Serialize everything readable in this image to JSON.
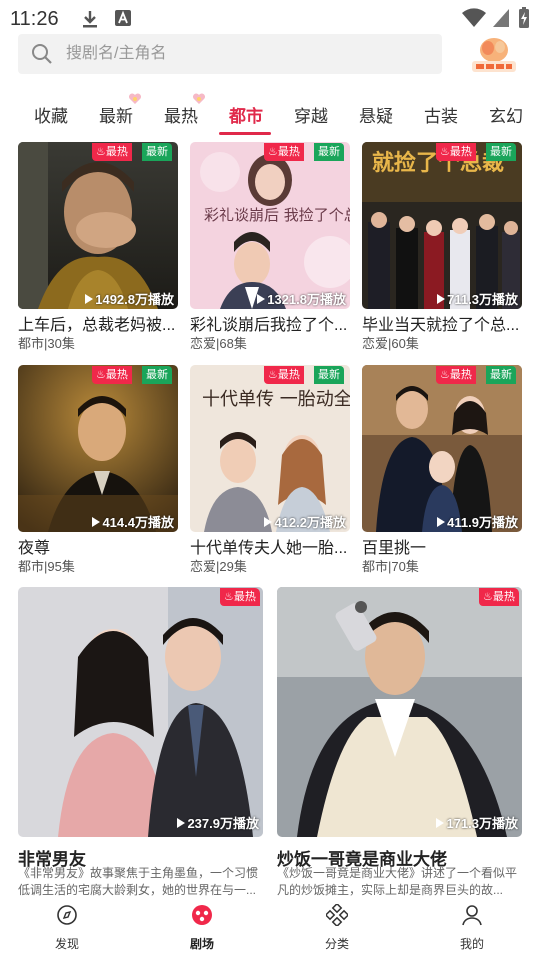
{
  "status_bar": {
    "time": "11:26"
  },
  "search": {
    "placeholder": "搜剧名/主角名",
    "value": ""
  },
  "welfare_logo_text": "领取福利",
  "tabs": [
    {
      "label": "收藏",
      "active": false,
      "badge": false
    },
    {
      "label": "最新",
      "active": false,
      "badge": true
    },
    {
      "label": "最热",
      "active": false,
      "badge": true
    },
    {
      "label": "都市",
      "active": true,
      "badge": false
    },
    {
      "label": "穿越",
      "active": false,
      "badge": false
    },
    {
      "label": "悬疑",
      "active": false,
      "badge": false
    },
    {
      "label": "古装",
      "active": false,
      "badge": false
    },
    {
      "label": "玄幻",
      "active": false,
      "badge": false
    }
  ],
  "badges": {
    "hot": "最热",
    "new": "最新"
  },
  "cards": [
    {
      "title": "上车后，总裁老妈被...",
      "meta": "都市|30集",
      "plays": "1492.8万播放",
      "hot": true,
      "new": true
    },
    {
      "title": "彩礼谈崩后我捡了个...",
      "meta": "恋爱|68集",
      "plays": "1321.8万播放",
      "hot": true,
      "new": true
    },
    {
      "title": "毕业当天就捡了个总...",
      "meta": "恋爱|60集",
      "plays": "711.3万播放",
      "hot": true,
      "new": true
    },
    {
      "title": "夜尊",
      "meta": "都市|95集",
      "plays": "414.4万播放",
      "hot": true,
      "new": true
    },
    {
      "title": "十代单传夫人她一胎...",
      "meta": "恋爱|29集",
      "plays": "412.2万播放",
      "hot": true,
      "new": true
    },
    {
      "title": "百里挑一",
      "meta": "都市|70集",
      "plays": "411.9万播放",
      "hot": true,
      "new": true
    }
  ],
  "poster_texts": {
    "p2": "彩礼谈崩后 我捡了个总裁当老公",
    "p3": "就捡了个总裁",
    "p5": "十代单传 一胎动全城"
  },
  "featured": [
    {
      "title": "非常男友",
      "desc": "《非常男友》故事聚焦于主角墨鱼，一个习惯低调生活的宅腐大龄剩女，她的世界在与一...",
      "plays": "237.9万播放",
      "hot": true
    },
    {
      "title": "炒饭一哥竟是商业大佬",
      "desc": "《炒饭一哥竟是商业大佬》讲述了一个看似平凡的炒饭摊主，实际上却是商界巨头的故...",
      "plays": "171.3万播放",
      "hot": true
    }
  ],
  "bottom_nav": [
    {
      "label": "发现",
      "icon": "compass-icon",
      "active": false
    },
    {
      "label": "剧场",
      "icon": "theater-icon",
      "active": true
    },
    {
      "label": "分类",
      "icon": "category-icon",
      "active": false
    },
    {
      "label": "我的",
      "icon": "person-icon",
      "active": false
    }
  ],
  "colors": {
    "accent": "#e0294a",
    "hot_badge": "#f0284a",
    "new_badge": "#1aa55a"
  }
}
